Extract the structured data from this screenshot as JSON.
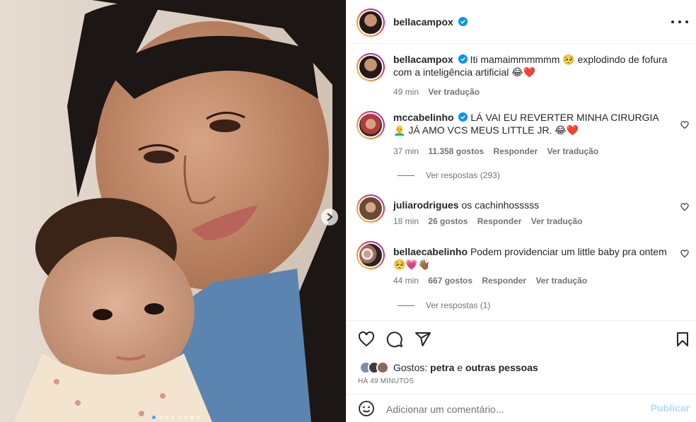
{
  "post": {
    "author": "bellacampox",
    "verified_icon": "verified-badge-icon",
    "more_icon": "more-options-icon"
  },
  "caption": {
    "username": "bellacampox",
    "text": "Iti mamaimmmmmm 🥺 explodindo de fofura com a inteligência artificial 😂❤️",
    "time": "49 min",
    "translate": "Ver tradução"
  },
  "comments": [
    {
      "username": "mccabelinho",
      "verified": true,
      "text": "LÁ VAI EU REVERTER MINHA CIRURGIA 👨‍🦲 JÁ AMO VCS MEUS LITTLE JR. 😂❤️",
      "time": "37 min",
      "likes": "11.358 gostos",
      "reply": "Responder",
      "translate": "Ver tradução",
      "view_replies": "Ver respostas (293)"
    },
    {
      "username": "juliarodrigues",
      "verified": false,
      "text": "os cachinhosssss",
      "time": "18 min",
      "likes": "26 gostos",
      "reply": "Responder",
      "translate": "Ver tradução"
    },
    {
      "username": "bellaecabelinho",
      "verified": false,
      "text": "Podem providenciar um little baby pra ontem 🥺💗👋🏾",
      "time": "44 min",
      "likes": "667 gostos",
      "reply": "Responder",
      "translate": "Ver tradução",
      "view_replies": "Ver respostas (1)"
    }
  ],
  "likes": {
    "prefix": "Gostos:",
    "first": "petra",
    "connector": "e",
    "others": "outras pessoas"
  },
  "time_ago": "HÁ 49 MINUTOS",
  "comment_box": {
    "placeholder": "Adicionar um comentário...",
    "publish": "Publicar"
  },
  "carousel": {
    "total": 8,
    "current": 1
  },
  "colors": {
    "accent": "#0095f6",
    "publish_disabled": "#b3dbff",
    "muted": "#737373"
  }
}
